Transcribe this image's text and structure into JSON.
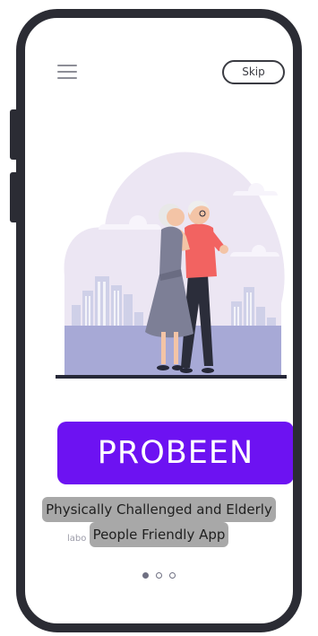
{
  "header": {
    "menu_icon": "hamburger-menu-icon",
    "skip_label": "Skip"
  },
  "illustration": {
    "subject": "elderly-couple-illustration",
    "colors": {
      "blob": "#ece6f3",
      "city": "#cfd0e8",
      "ground": "#a7a9d6",
      "woman_dress": "#7d7f96",
      "man_shirt": "#f26361",
      "man_pants": "#2b2d3a"
    }
  },
  "brand": {
    "title": "PROBEEN",
    "background": "#6d12f2"
  },
  "tagline": {
    "line1": "Physically Challenged and Elderly",
    "line2": "People Friendly App",
    "partial_text": "labo"
  },
  "pagination": {
    "total": 3,
    "current": 1
  }
}
